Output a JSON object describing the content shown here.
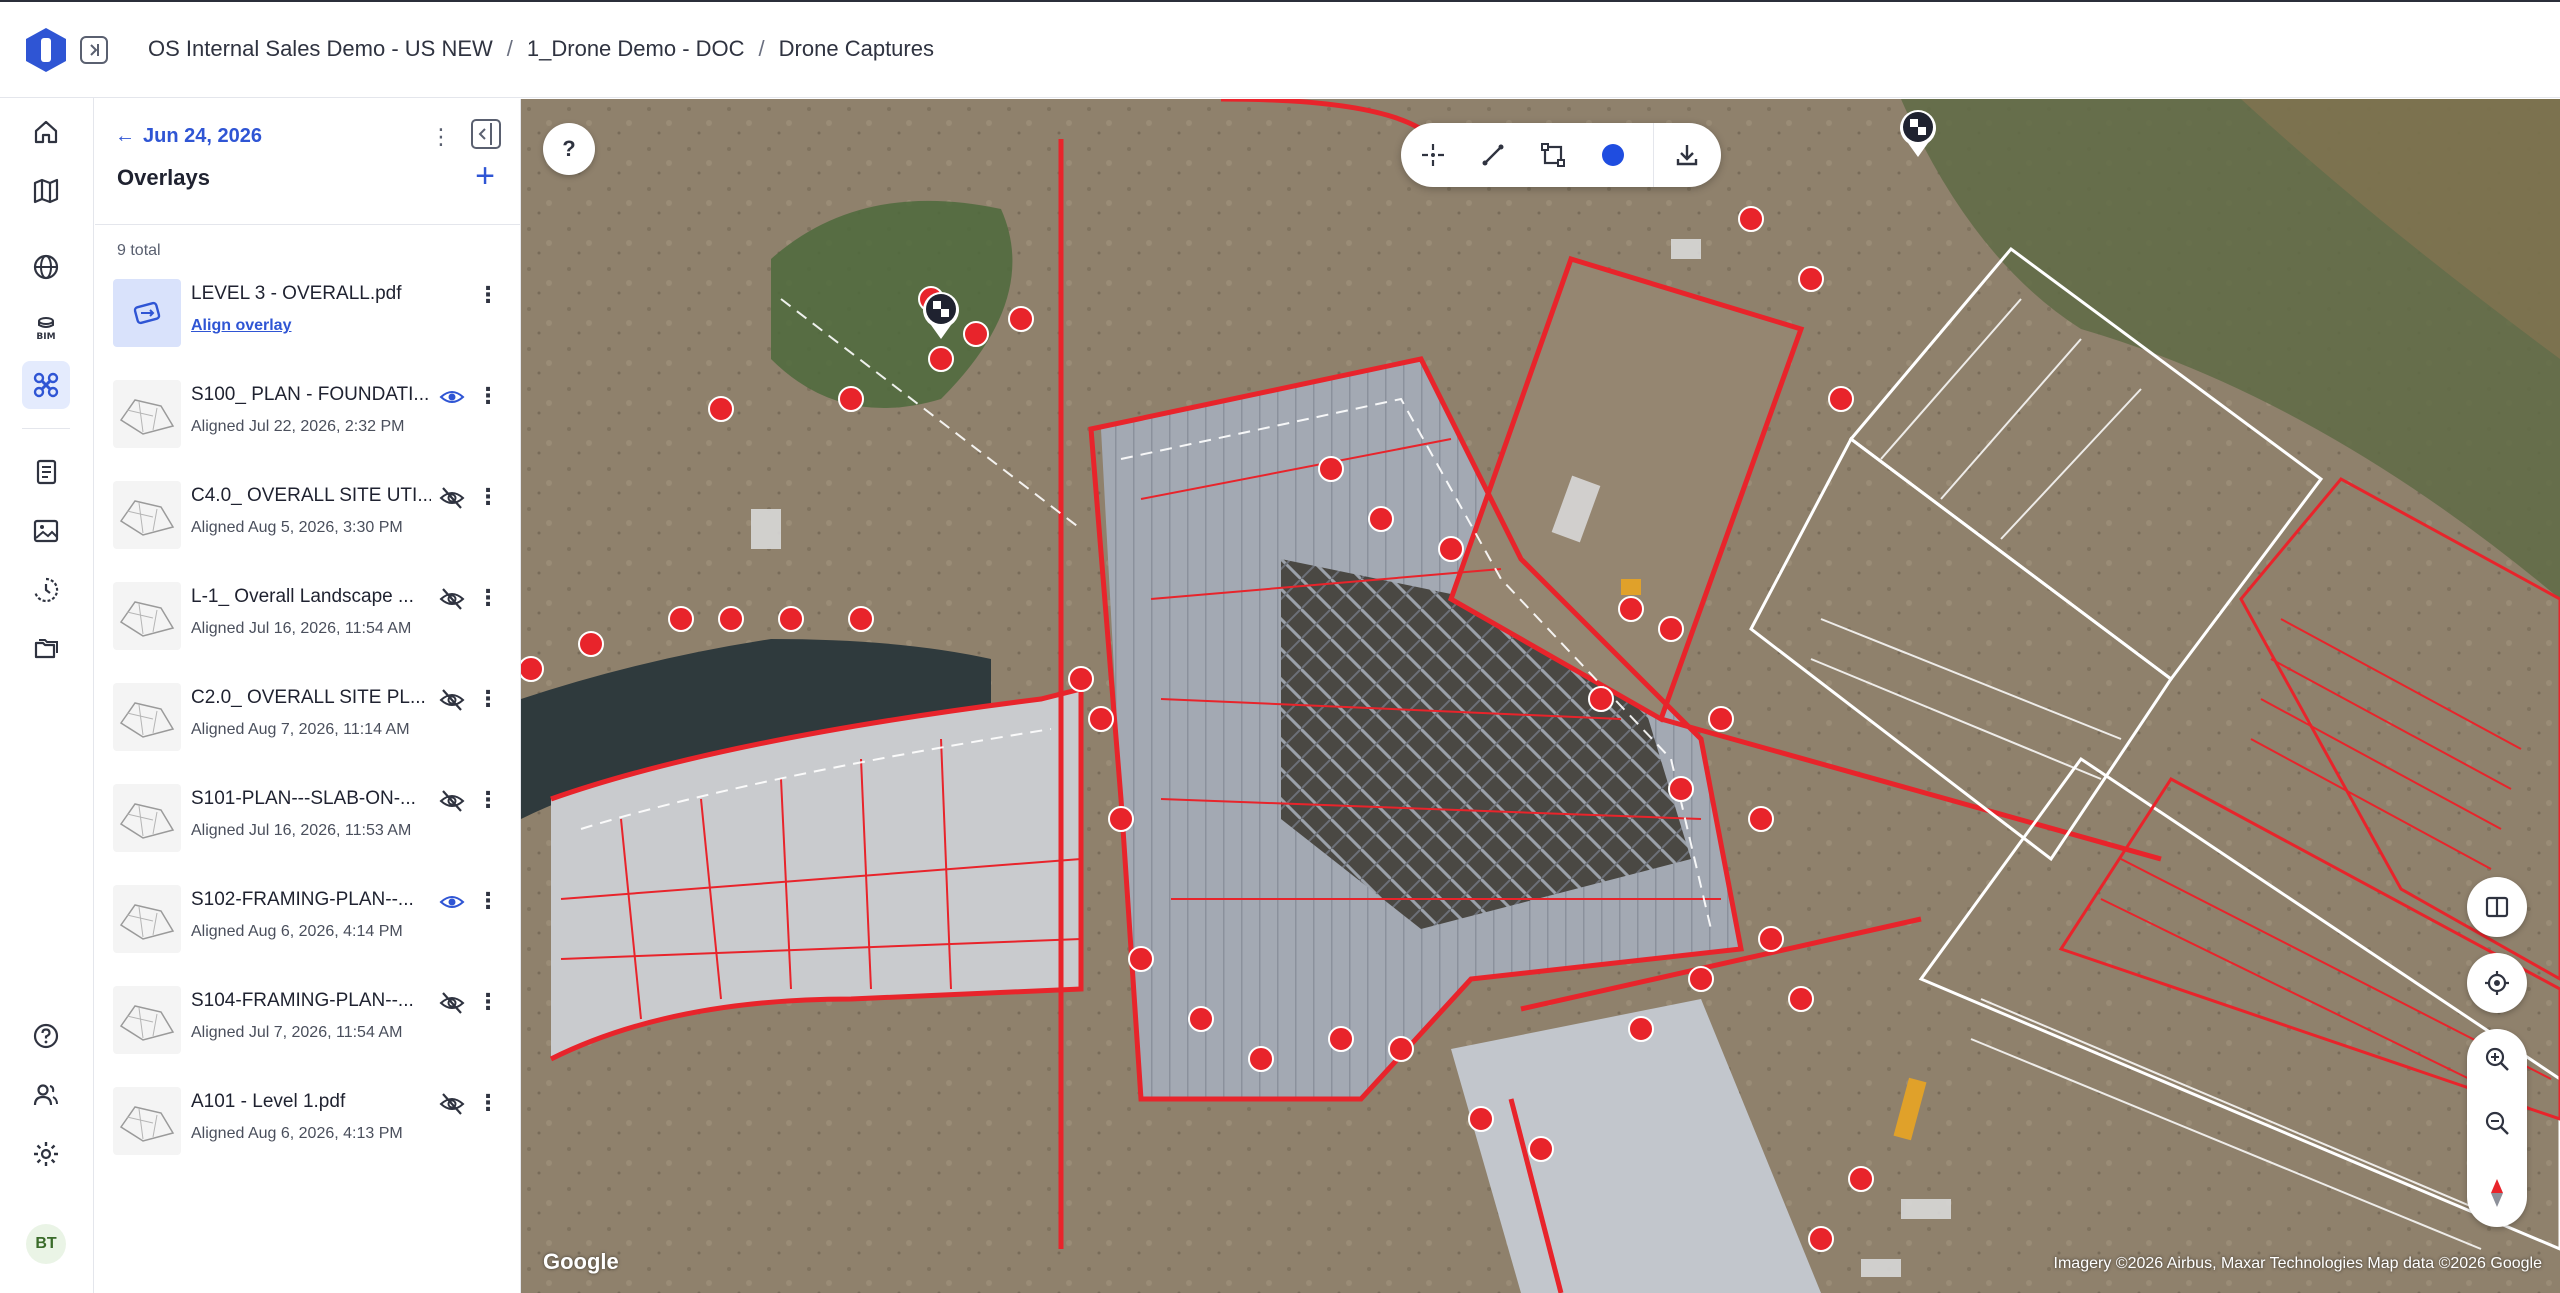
{
  "breadcrumb": [
    "OS Internal Sales Demo - US NEW",
    "1_Drone Demo - DOC",
    "Drone Captures"
  ],
  "breadcrumb_sep": "/",
  "panel": {
    "back_label": "Jun 24, 2026",
    "title": "Overlays",
    "add_label": "+",
    "total": "9 total"
  },
  "overlays": [
    {
      "name": "LEVEL 3 - OVERALL.pdf",
      "sub": "Align overlay",
      "link": true,
      "eye": "none"
    },
    {
      "name": "S100_ PLAN - FOUNDATI...",
      "sub": "Aligned Jul 22, 2026, 2:32 PM",
      "link": false,
      "eye": "visible"
    },
    {
      "name": "C4.0_ OVERALL SITE UTI...",
      "sub": "Aligned Aug 5, 2026, 3:30 PM",
      "link": false,
      "eye": "hidden"
    },
    {
      "name": "L-1_ Overall Landscape ...",
      "sub": "Aligned Jul 16, 2026, 11:54 AM",
      "link": false,
      "eye": "hidden"
    },
    {
      "name": "C2.0_ OVERALL SITE PL...",
      "sub": "Aligned Aug 7, 2026, 11:14 AM",
      "link": false,
      "eye": "hidden"
    },
    {
      "name": "S101-PLAN---SLAB-ON-...",
      "sub": "Aligned Jul 16, 2026, 11:53 AM",
      "link": false,
      "eye": "hidden"
    },
    {
      "name": "S102-FRAMING-PLAN--...",
      "sub": "Aligned Aug 6, 2026, 4:14 PM",
      "link": false,
      "eye": "visible"
    },
    {
      "name": "S104-FRAMING-PLAN--...",
      "sub": "Aligned Jul 7, 2026, 11:54 AM",
      "link": false,
      "eye": "hidden"
    },
    {
      "name": "A101 - Level 1.pdf",
      "sub": "Aligned Aug 6, 2026, 4:13 PM",
      "link": false,
      "eye": "hidden"
    }
  ],
  "user": {
    "initials": "BT"
  },
  "map": {
    "help_label": "?",
    "google_mark": "Google",
    "attribution": "Imagery ©2026 Airbus, Maxar Technologies Map data ©2026 Google",
    "color_swatch": "#1f4de0"
  },
  "colors": {
    "accent": "#2f55d4",
    "overlay_red": "#e8242b"
  },
  "icons": {
    "rail": [
      "home-icon",
      "map-icon",
      "globe-icon",
      "bim-icon",
      "drone-icon",
      "document-icon",
      "image-icon",
      "history-icon",
      "folders-icon",
      "help-icon",
      "users-icon",
      "settings-icon"
    ]
  }
}
